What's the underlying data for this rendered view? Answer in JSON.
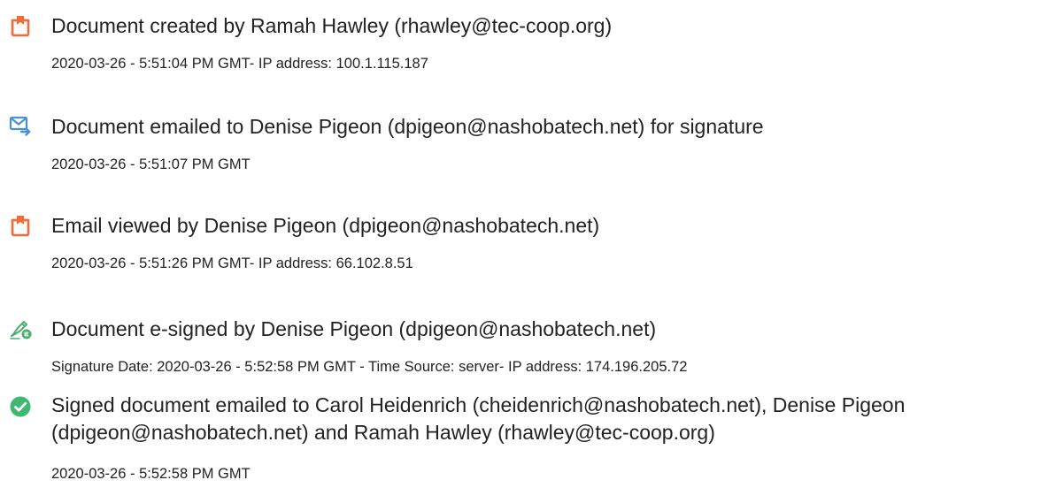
{
  "colors": {
    "text": "#222222",
    "doc_icon": "#f26c3a",
    "mail_icon": "#4a90d9",
    "sign_icon": "#4caf70",
    "check_icon": "#3fb872"
  },
  "events": [
    {
      "icon": "document-created-icon",
      "title": "Document created by Ramah Hawley (rhawley@tec-coop.org)",
      "meta": "2020-03-26 - 5:51:04 PM GMT- IP address: 100.1.115.187"
    },
    {
      "icon": "email-sent-icon",
      "title": "Document emailed to Denise Pigeon (dpigeon@nashobatech.net) for signature",
      "meta": "2020-03-26 - 5:51:07 PM GMT"
    },
    {
      "icon": "email-viewed-icon",
      "title": "Email viewed by Denise Pigeon (dpigeon@nashobatech.net)",
      "meta": "2020-03-26 - 5:51:26 PM GMT- IP address: 66.102.8.51"
    },
    {
      "icon": "e-sign-icon",
      "title": "Document e-signed by Denise Pigeon (dpigeon@nashobatech.net)",
      "meta": "Signature Date: 2020-03-26 - 5:52:58 PM GMT - Time Source: server- IP address: 174.196.205.72"
    },
    {
      "icon": "check-circle-icon",
      "title": "Signed document emailed to Carol Heidenrich (cheidenrich@nashobatech.net), Denise Pigeon (dpigeon@nashobatech.net) and Ramah Hawley (rhawley@tec-coop.org)",
      "meta": "2020-03-26 - 5:52:58 PM GMT"
    }
  ]
}
